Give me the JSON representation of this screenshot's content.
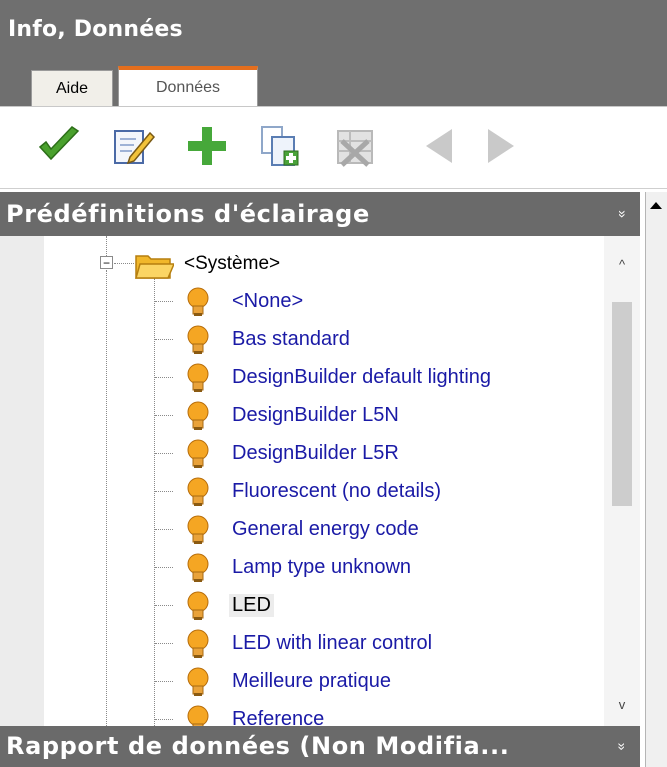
{
  "header": {
    "title": "Info, Données"
  },
  "tabs": [
    {
      "label": "Aide",
      "active": false
    },
    {
      "label": "Données",
      "active": true
    }
  ],
  "toolbar": {
    "buttons": [
      {
        "icon": "checkmark-icon",
        "enabled": true
      },
      {
        "icon": "edit-icon",
        "enabled": true
      },
      {
        "icon": "plus-icon",
        "enabled": true
      },
      {
        "icon": "copy-add-icon",
        "enabled": true
      },
      {
        "icon": "delete-list-icon",
        "enabled": false
      },
      {
        "icon": "arrow-left-icon",
        "enabled": false
      },
      {
        "icon": "arrow-right-icon",
        "enabled": false
      }
    ]
  },
  "panel": {
    "title": "Prédéfinitions d'éclairage",
    "collapse_glyph": "»"
  },
  "tree": {
    "root": {
      "label": "<Système>",
      "expanded": true,
      "expander": "−"
    },
    "items": [
      {
        "label": "<None>"
      },
      {
        "label": "Bas standard"
      },
      {
        "label": "DesignBuilder default lighting"
      },
      {
        "label": "DesignBuilder L5N"
      },
      {
        "label": "DesignBuilder L5R"
      },
      {
        "label": "Fluorescent (no details)"
      },
      {
        "label": "General energy code"
      },
      {
        "label": "Lamp type unknown"
      },
      {
        "label": "LED"
      },
      {
        "label": "LED with linear control"
      },
      {
        "label": "Meilleure pratique"
      },
      {
        "label": "Reference"
      }
    ],
    "selected_index": 8,
    "scroll_up_glyph": "^",
    "scroll_down_glyph": "v"
  },
  "panel2": {
    "title": "Rapport de données (Non Modifia...",
    "collapse_glyph": "»"
  },
  "colors": {
    "header_bg": "#6f6f6f",
    "active_tab_accent": "#e46e1d",
    "link_text": "#1a1aa6"
  }
}
